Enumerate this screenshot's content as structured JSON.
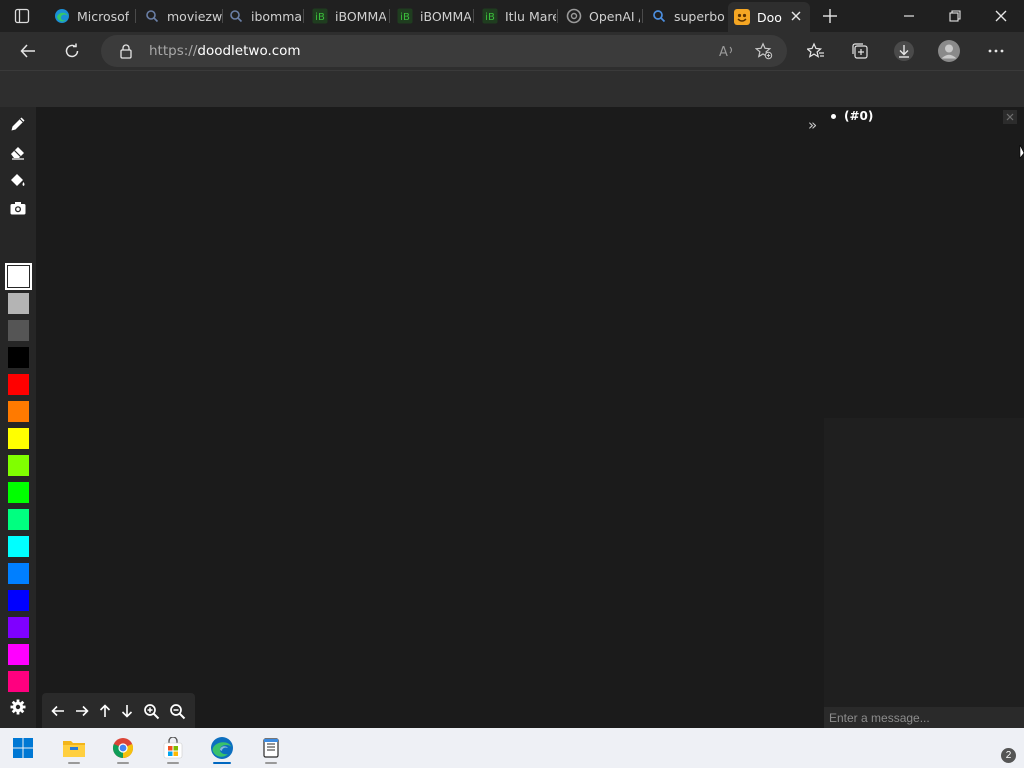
{
  "browser": {
    "tabs": [
      {
        "title": "Microsof",
        "icon": "edge-icon"
      },
      {
        "title": "moviezw",
        "icon": "search-icon"
      },
      {
        "title": "ibomma",
        "icon": "search-icon"
      },
      {
        "title": "iBOMMA",
        "icon": "ibomma-icon"
      },
      {
        "title": "iBOMMA",
        "icon": "ibomma-icon"
      },
      {
        "title": "Itlu Mare",
        "icon": "ibomma-icon"
      },
      {
        "title": "OpenAI /",
        "icon": "openai-icon"
      },
      {
        "title": "superboc",
        "icon": "search-icon"
      },
      {
        "title": "Doo",
        "icon": "doodle-icon",
        "active": true
      }
    ],
    "address": {
      "scheme": "https://",
      "host": "doodletwo.com"
    }
  },
  "tools": [
    "pencil-icon",
    "eraser-icon",
    "paint-bucket-icon",
    "camera-icon"
  ],
  "palette": [
    "#ffffff",
    "#b4b4b4",
    "#555555",
    "#000000",
    "#ff0000",
    "#ff7a00",
    "#ffff00",
    "#80ff00",
    "#00ff00",
    "#00ff80",
    "#00ffff",
    "#007fff",
    "#0000ff",
    "#7f00ff",
    "#ff00ff",
    "#ff007f"
  ],
  "selected_color": "#ffffff",
  "users": {
    "item": "(#0)"
  },
  "chat": {
    "placeholder": "Enter a message..."
  },
  "collapse_label": "»",
  "taskbar": {
    "apps": [
      "windows-start-icon",
      "file-explorer-icon",
      "chrome-icon",
      "microsoft-store-icon",
      "edge-icon",
      "notepad-icon"
    ],
    "notification_count": "2"
  }
}
